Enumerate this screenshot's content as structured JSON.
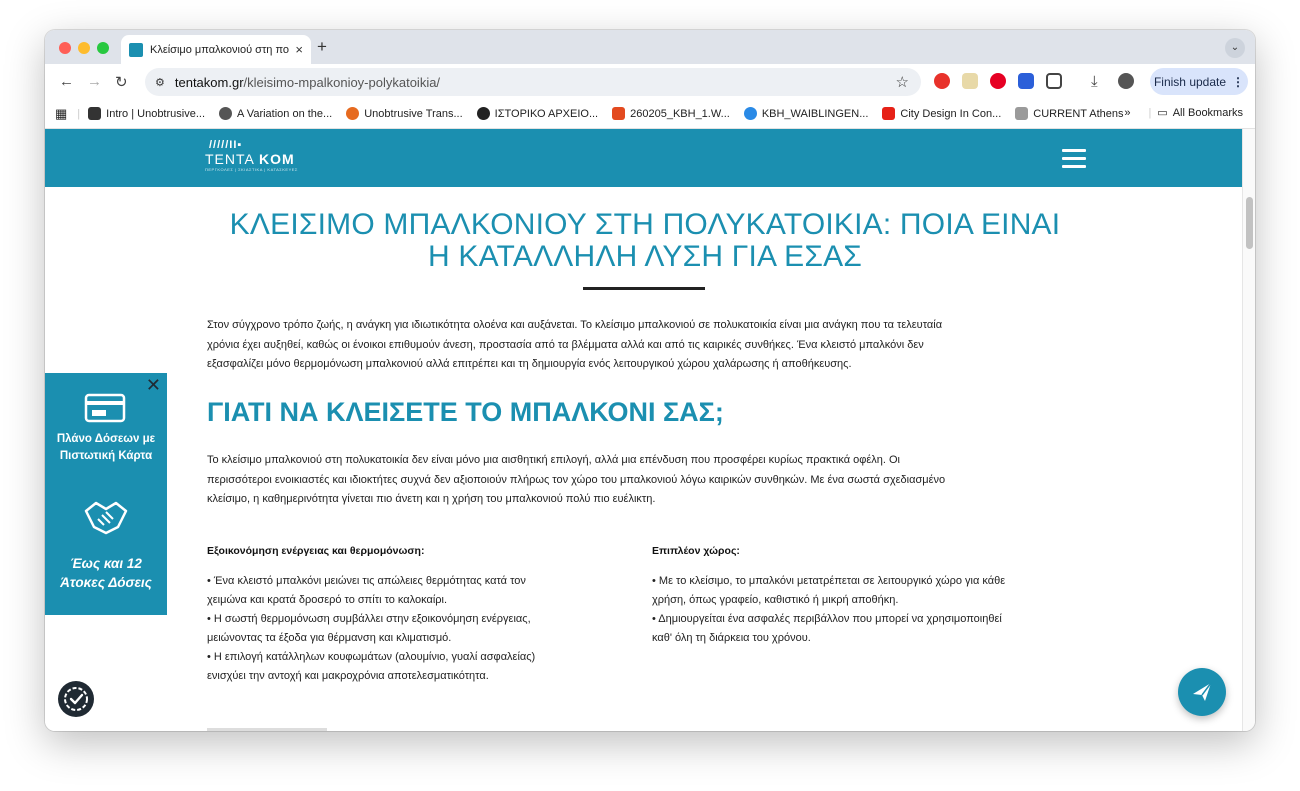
{
  "browser": {
    "tab": {
      "title": "Κλείσιμο μπαλκονιού στη πολ",
      "close": "×"
    },
    "new_tab": "+",
    "tab_menu": "⌄",
    "address": {
      "host": "tentakom.gr",
      "path": "/kleisimo-mpalkonioy-polykatoikia/"
    },
    "finish_update": "Finish update",
    "bookmarks": [
      {
        "label": "Intro | Unobtrusive...",
        "color": "#333333"
      },
      {
        "label": "A Variation on the...",
        "color": "#555555"
      },
      {
        "label": "Unobtrusive Trans...",
        "color": "#e66a1f"
      },
      {
        "label": "ΙΣΤΟΡΙΚΟ ΑΡΧΕΙΟ...",
        "color": "#222222"
      },
      {
        "label": "260205_KBH_1.W...",
        "color": "#e34a1f"
      },
      {
        "label": "KBH_WAIBLINGEN...",
        "color": "#2a8ae6"
      },
      {
        "label": "City Design In Con...",
        "color": "#e62117"
      },
      {
        "label": "CURRENT Athens",
        "color": "#9a9a9a"
      }
    ],
    "bookmarks_overflow": "»",
    "all_bookmarks": "All Bookmarks"
  },
  "site": {
    "logo": {
      "mark": "/////II▪",
      "text_a": "TENTA ",
      "text_b": "KOM",
      "sub": "ΠΕΡΓΚΟΛΕΣ | ΣΚΙΑΣΤΙΚΑ | ΚΑΤΑΣΚΕΥΕΣ"
    },
    "title_line1": "ΚΛΕΙΣΙΜΟ ΜΠΑΛΚΟΝΙΟΥ ΣΤΗ ΠΟΛΥΚΑΤΟΙΚΙΑ: ΠΟΙΑ ΕΙΝΑΙ",
    "title_line2": "Η ΚΑΤΑΛΛΗΛΗ ΛΥΣΗ ΓΙΑ ΕΣΑΣ",
    "intro": [
      "Στον σύγχρονο τρόπο ζωής, η ανάγκη για ιδιωτικότητα ολοένα και αυξάνεται. Το κλείσιμο μπαλκονιού σε πολυκατοικία είναι μια ανάγκη που τα τελευταία",
      "χρόνια έχει αυξηθεί, καθώς οι ένοικοι επιθυμούν άνεση, προστασία από τα βλέμματα αλλά και από τις καιρικές συνθήκες. Ένα κλειστό μπαλκόνι δεν",
      "εξασφαλίζει μόνο θερμομόνωση μπαλκονιού αλλά επιτρέπει και τη δημιουργία ενός λειτουργικού χώρου χαλάρωσης ή αποθήκευσης."
    ],
    "section_title": "ΓΙΑΤΙ ΝΑ ΚΛΕΙΣΕΤΕ ΤΟ ΜΠΑΛΚΟΝΙ ΣΑΣ;",
    "section_para": [
      "Το κλείσιμο μπαλκονιού στη πολυκατοικία δεν είναι μόνο μια αισθητική επιλογή, αλλά μια επένδυση που προσφέρει κυρίως πρακτικά οφέλη. Οι",
      "περισσότεροι ενοικιαστές και ιδιοκτήτες συχνά δεν αξιοποιούν πλήρως τον χώρο του μπαλκονιού λόγω καιρικών συνθηκών. Με ένα σωστά σχεδιασμένο",
      "κλείσιμο, η καθημερινότητα γίνεται πιο άνετη και η χρήση του μπαλκονιού πολύ πιο ευέλικτη."
    ],
    "col1": {
      "heading": "Εξοικονόμηση ενέργειας και θερμομόνωση:",
      "lines": [
        "•  Ένα κλειστό μπαλκόνι μειώνει τις απώλειες θερμότητας κατά τον",
        "χειμώνα και κρατά δροσερό το σπίτι το καλοκαίρι.",
        "•  Η σωστή θερμομόνωση συμβάλλει στην εξοικονόμηση ενέργειας,",
        "μειώνοντας τα έξοδα για θέρμανση και κλιματισμό.",
        "•  Η επιλογή κατάλληλων κουφωμάτων (αλουμίνιο, γυαλί ασφαλείας)",
        "ενισχύει την αντοχή και μακροχρόνια αποτελεσματικότητα."
      ]
    },
    "col2": {
      "heading": "Επιπλέον χώρος:",
      "lines": [
        "•  Με το κλείσιμο, το μπαλκόνι μετατρέπεται σε λειτουργικό χώρο για κάθε",
        "χρήση, όπως γραφείο, καθιστικό ή μικρή αποθήκη.",
        "•  Δημιουργείται ένα ασφαλές περιβάλλον που μπορεί να χρησιμοποιηθεί",
        "καθ' όλη τη διάρκεια του χρόνου."
      ]
    },
    "promo": {
      "close": "✕",
      "line1": "Πλάνο Δόσεων με",
      "line2": "Πιστωτική Κάρτα",
      "line3": "Έως και 12",
      "line4": "Άτοκες Δόσεις"
    }
  },
  "colors": {
    "brand": "#1b8fb0",
    "dark": "#202a33"
  }
}
